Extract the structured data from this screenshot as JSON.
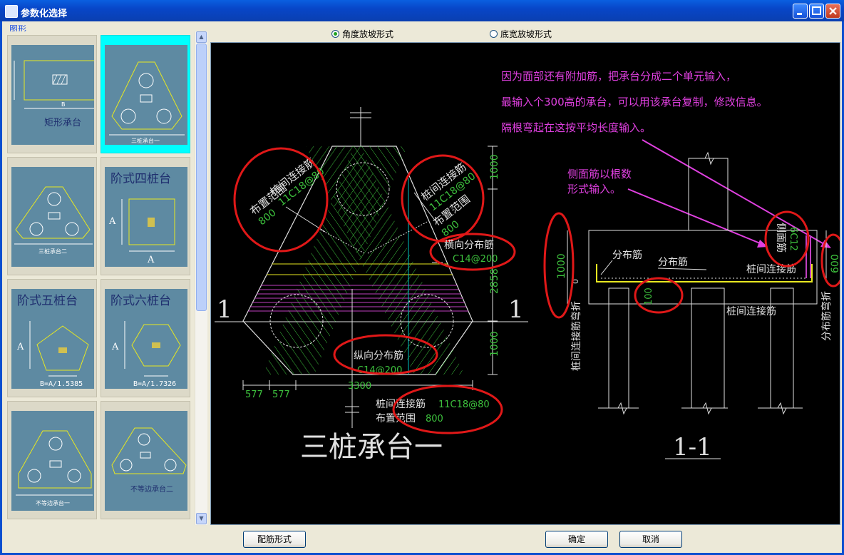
{
  "window": {
    "title": "参数化选择"
  },
  "panel": {
    "group_label": "图形"
  },
  "thumbnails": [
    {
      "label": "矩形承台",
      "dim": "B"
    },
    {
      "label": "三桩承台一"
    },
    {
      "label": "三桩承台二"
    },
    {
      "label": "阶式四桩台",
      "dim": "A"
    },
    {
      "label": "阶式五桩台",
      "dim": "A",
      "formula": "B=A/1.5385"
    },
    {
      "label": "阶式六桩台",
      "dim": "A",
      "formula": "B=A/1.7326"
    },
    {
      "label": "不等边承台一"
    },
    {
      "label": "不等边承台二"
    }
  ],
  "options": {
    "angle_slope": "角度放坡形式",
    "bottom_width_slope": "底宽放坡形式",
    "selected": "角度放坡形式"
  },
  "drawing": {
    "notes": [
      "因为面部还有附加筋，把承台分成二个单元输入，",
      "最输入个300高的承台，可以用该承台复制，修改信息。",
      "隔根弯起在这按平均长度输入。"
    ],
    "side_note": [
      "侧面筋以根数",
      "形式输入。"
    ],
    "left_rebar": {
      "name": "桩间连接筋",
      "spec": "11C18@80",
      "range_label": "布置范围",
      "range": "800"
    },
    "right_rebar": {
      "name": "桩间连接筋",
      "spec": "11C18@80",
      "range_label": "布置范围",
      "range": "800"
    },
    "transverse": {
      "name": "横向分布筋",
      "spec": "C14@200"
    },
    "longitudinal": {
      "name": "纵向分布筋",
      "spec": "C14@200"
    },
    "bottom_rebar": {
      "name": "桩间连接筋",
      "spec": "11C18@80",
      "range_label": "布置范围",
      "range": "800"
    },
    "dims": {
      "top": "1000",
      "mid": "2858",
      "bottom": "1000",
      "width": "3300",
      "seg1": "577",
      "seg2": "577"
    },
    "section_mark": "1",
    "plan_title": "三桩承台一",
    "section_title": "1-1",
    "section": {
      "height": "1000",
      "zero": "0",
      "side_height": "600",
      "hundred": "100",
      "dist1": "分布筋",
      "dist2": "分布筋",
      "tie_top": "桩间连接筋",
      "tie_bottom": "桩间连接筋",
      "side_bar": "侧面筋",
      "side_spec": "6C12",
      "left_vertical": "桩间连接筋弯折",
      "right_vertical": "分布筋弯折"
    }
  },
  "buttons": {
    "rebar_form": "配筋形式",
    "ok": "确定",
    "cancel": "取消"
  }
}
